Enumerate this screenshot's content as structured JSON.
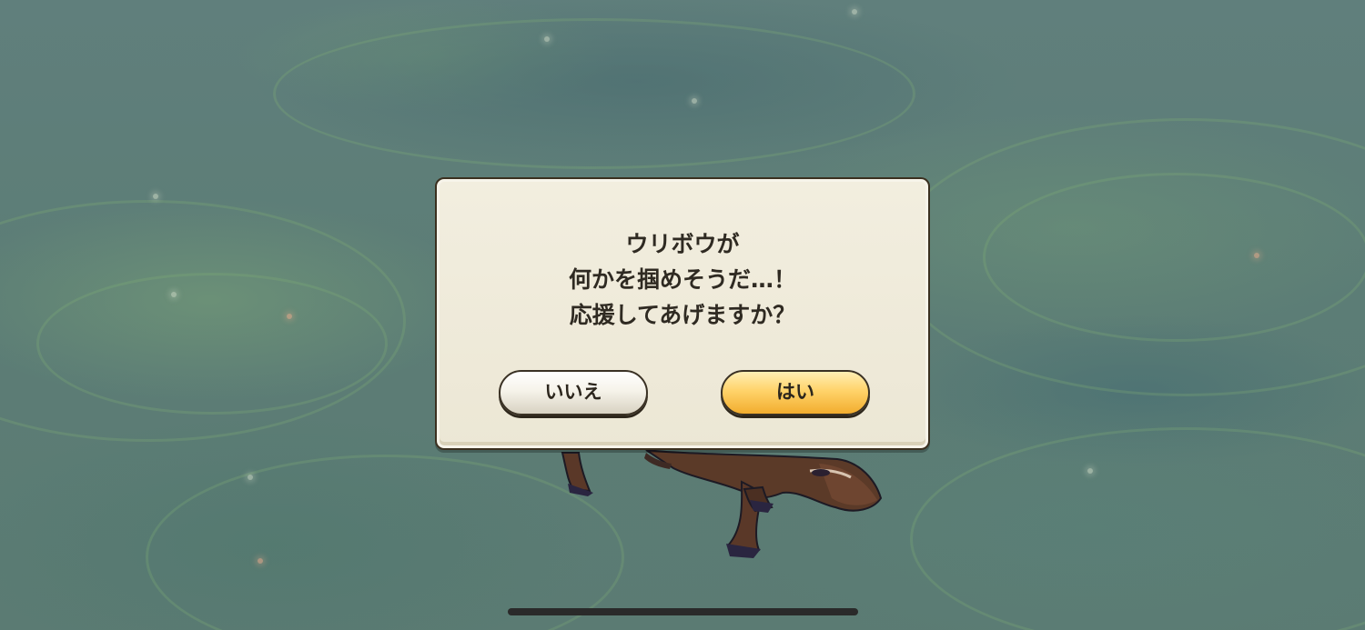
{
  "dialog": {
    "message_lines": [
      "ウリボウが",
      "何かを掴めそうだ…！",
      "応援してあげますか？"
    ],
    "no_label": "いいえ",
    "yes_label": "はい"
  },
  "colors": {
    "dialog_background": "#eee9d8",
    "dialog_border": "#3b3020",
    "yes_button": "#ffcf5e",
    "no_button": "#f3f0e6",
    "text": "#2f2a22"
  }
}
